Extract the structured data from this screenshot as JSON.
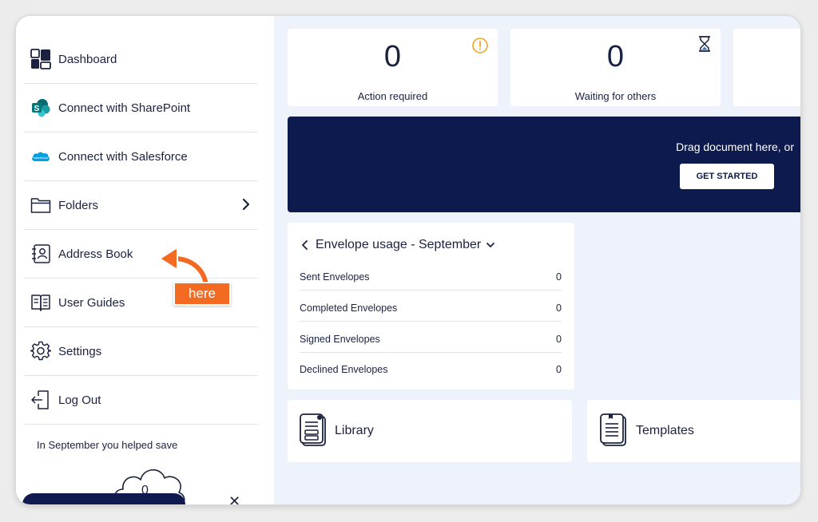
{
  "sidebar": {
    "items": [
      {
        "label": "Dashboard",
        "icon": "dashboard-icon"
      },
      {
        "label": "Connect with SharePoint",
        "icon": "sharepoint-icon"
      },
      {
        "label": "Connect with Salesforce",
        "icon": "salesforce-icon"
      },
      {
        "label": "Folders",
        "icon": "folder-icon"
      },
      {
        "label": "Address Book",
        "icon": "address-book-icon"
      },
      {
        "label": "User Guides",
        "icon": "user-guides-icon"
      },
      {
        "label": "Settings",
        "icon": "gear-icon"
      },
      {
        "label": "Log Out",
        "icon": "logout-icon"
      }
    ],
    "save_text": "In September you helped save",
    "save_count": "0"
  },
  "stats": [
    {
      "value": "0",
      "label": "Action required",
      "icon": "alert-circle-icon"
    },
    {
      "value": "0",
      "label": "Waiting for others",
      "icon": "hourglass-icon"
    }
  ],
  "banner": {
    "text": "Drag document here, or",
    "button_label": "GET STARTED"
  },
  "usage": {
    "title": "Envelope usage - ",
    "month": "September",
    "rows": [
      {
        "label": "Sent Envelopes",
        "value": "0"
      },
      {
        "label": "Completed Envelopes",
        "value": "0"
      },
      {
        "label": "Signed Envelopes",
        "value": "0"
      },
      {
        "label": "Declined Envelopes",
        "value": "0"
      }
    ]
  },
  "tiles": [
    {
      "label": "Library",
      "icon": "library-icon"
    },
    {
      "label": "Templates",
      "icon": "templates-icon"
    }
  ],
  "annotation": {
    "label": "here"
  },
  "colors": {
    "navy": "#0d1a4d",
    "accent_orange": "#f36a23",
    "alert_orange": "#f5a623",
    "page_bg": "#eef3fb"
  }
}
